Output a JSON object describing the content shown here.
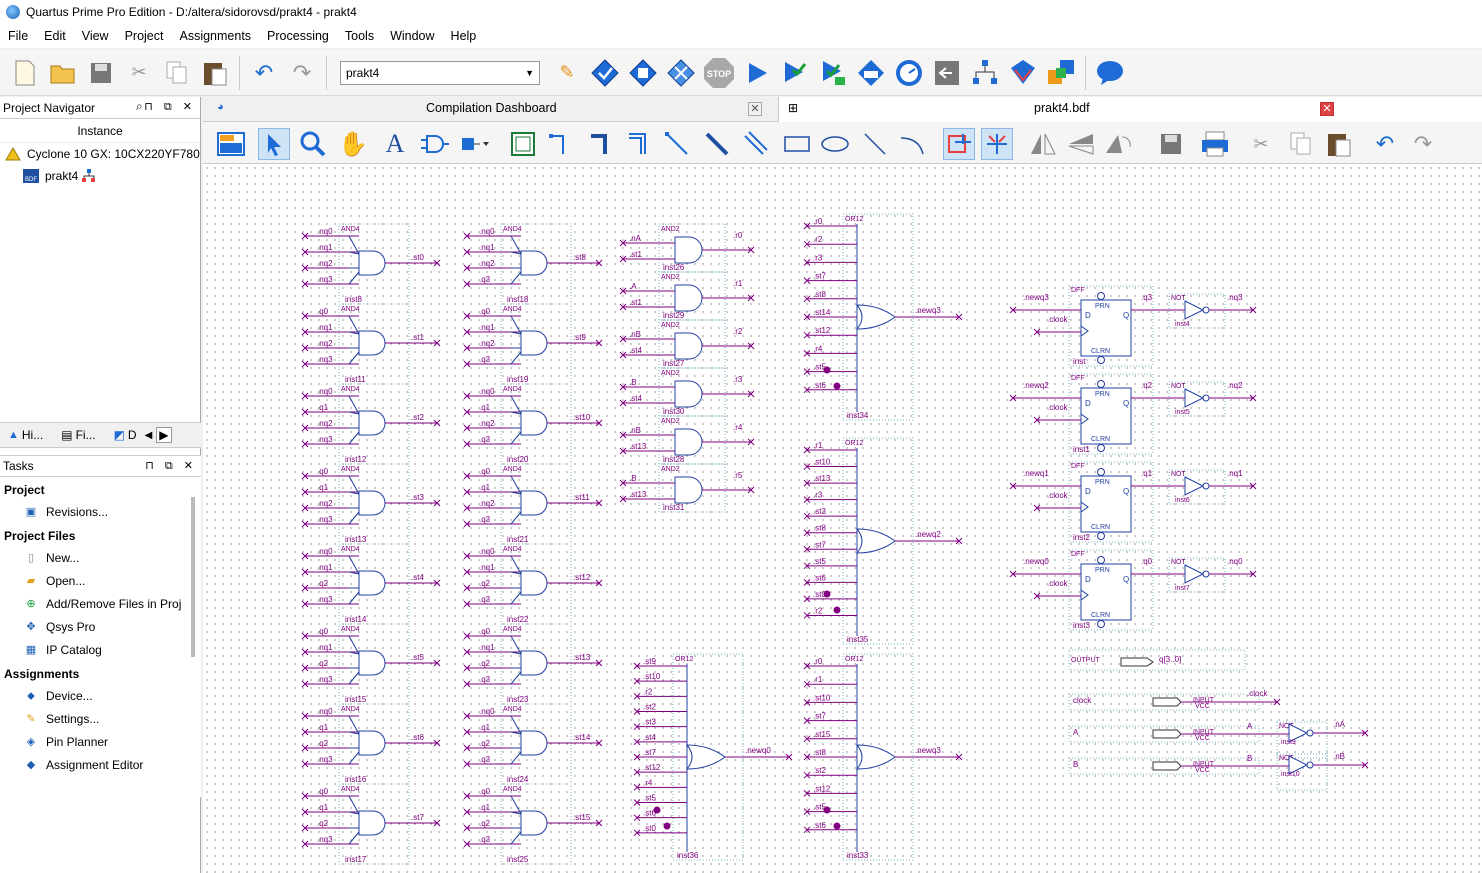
{
  "window": {
    "title": "Quartus Prime Pro Edition - D:/altera/sidorovsd/prakt4 - prakt4"
  },
  "menu": [
    "File",
    "Edit",
    "View",
    "Project",
    "Assignments",
    "Processing",
    "Tools",
    "Window",
    "Help"
  ],
  "toolbar": {
    "project_combo": "prakt4"
  },
  "navigator": {
    "title": "Project Navigator",
    "column": "Instance",
    "device": "Cyclone 10 GX: 10CX220YF780",
    "entity": "prakt4",
    "tabs": [
      "Hi...",
      "Fi...",
      "D"
    ]
  },
  "tasks": {
    "title": "Tasks",
    "groups": [
      {
        "name": "Project",
        "items": [
          "Revisions..."
        ]
      },
      {
        "name": "Project Files",
        "items": [
          "New...",
          "Open...",
          "Add/Remove Files in Proj",
          "Qsys Pro",
          "IP Catalog"
        ]
      },
      {
        "name": "Assignments",
        "items": [
          "Device...",
          "Settings...",
          "Pin Planner",
          "Assignment Editor"
        ]
      }
    ]
  },
  "doc_tabs": {
    "dashboard": "Compilation Dashboard",
    "bdf": "prakt4.bdf"
  },
  "schematic": {
    "and_col1": [
      {
        "inst": "inst8",
        "out": "st0",
        "ins": [
          "nq0",
          "nq1",
          "nq2",
          "nq3"
        ]
      },
      {
        "inst": "inst11",
        "out": "st1",
        "ins": [
          "q0",
          "nq1",
          "nq2",
          "nq3"
        ]
      },
      {
        "inst": "inst12",
        "out": "st2",
        "ins": [
          "nq0",
          "q1",
          "nq2",
          "nq3"
        ]
      },
      {
        "inst": "inst13",
        "out": "st3",
        "ins": [
          "q0",
          "q1",
          "nq2",
          "nq3"
        ]
      },
      {
        "inst": "inst14",
        "out": "st4",
        "ins": [
          "nq0",
          "nq1",
          "q2",
          "nq3"
        ]
      },
      {
        "inst": "inst15",
        "out": "st5",
        "ins": [
          "q0",
          "nq1",
          "q2",
          "nq3"
        ]
      },
      {
        "inst": "inst16",
        "out": "st6",
        "ins": [
          "nq0",
          "q1",
          "q2",
          "nq3"
        ]
      },
      {
        "inst": "inst17",
        "out": "st7",
        "ins": [
          "q0",
          "q1",
          "q2",
          "nq3"
        ]
      }
    ],
    "and_col2": [
      {
        "inst": "inst18",
        "out": "st8",
        "ins": [
          "nq0",
          "nq1",
          "nq2",
          "q3"
        ]
      },
      {
        "inst": "inst19",
        "out": "st9",
        "ins": [
          "q0",
          "nq1",
          "nq2",
          "q3"
        ]
      },
      {
        "inst": "inst20",
        "out": "st10",
        "ins": [
          "nq0",
          "q1",
          "nq2",
          "q3"
        ]
      },
      {
        "inst": "inst21",
        "out": "st11",
        "ins": [
          "q0",
          "q1",
          "nq2",
          "q3"
        ]
      },
      {
        "inst": "inst22",
        "out": "st12",
        "ins": [
          "nq0",
          "nq1",
          "q2",
          "q3"
        ]
      },
      {
        "inst": "inst23",
        "out": "st13",
        "ins": [
          "q0",
          "nq1",
          "q2",
          "q3"
        ]
      },
      {
        "inst": "inst24",
        "out": "st14",
        "ins": [
          "nq0",
          "q1",
          "q2",
          "q3"
        ]
      },
      {
        "inst": "inst25",
        "out": "st15",
        "ins": [
          "q0",
          "q1",
          "q2",
          "q3"
        ]
      }
    ],
    "and2": [
      {
        "inst": "inst26",
        "out": "r0",
        "ins": [
          "nA",
          "st1"
        ]
      },
      {
        "inst": "inst29",
        "out": "r1",
        "ins": [
          "A",
          "st1"
        ]
      },
      {
        "inst": "inst27",
        "out": "r2",
        "ins": [
          "nB",
          "st4"
        ]
      },
      {
        "inst": "inst30",
        "out": "r3",
        "ins": [
          "B",
          "st4"
        ]
      },
      {
        "inst": "inst28",
        "out": "r4",
        "ins": [
          "nB",
          "st13"
        ]
      },
      {
        "inst": "inst31",
        "out": "r5",
        "ins": [
          "B",
          "st13"
        ]
      }
    ],
    "or12": [
      {
        "inst": "inst34",
        "out": "newq3",
        "ins": [
          "r0",
          "r2",
          "r3",
          "st7",
          "st8",
          "st14",
          "st12",
          "r4",
          "st5",
          "st6"
        ]
      },
      {
        "inst": "inst35",
        "out": "newq2",
        "ins": [
          "r1",
          "st10",
          "st13",
          "r3",
          "st3",
          "st8",
          "st7",
          "st5",
          "st6",
          "st0",
          "r2"
        ]
      },
      {
        "inst": "inst36",
        "out": "newq0",
        "ins": [
          "st9",
          "st10",
          "r2",
          "st2",
          "st3",
          "st4",
          "st7",
          "st12",
          "r4",
          "st5",
          "st6",
          "st0"
        ]
      },
      {
        "inst": "inst33",
        "out": "newq3",
        "ins": [
          "r0",
          "r1",
          "st10",
          "st7",
          "st15",
          "st8",
          "st2",
          "st12",
          "st5",
          "st6"
        ]
      }
    ],
    "dff": [
      {
        "inst": "inst",
        "d": "newq3",
        "q": "q3",
        "nq": "nq3",
        "not": "inst4"
      },
      {
        "inst": "inst1",
        "d": "newq2",
        "q": "q2",
        "nq": "nq2",
        "not": "inst5"
      },
      {
        "inst": "inst2",
        "d": "newq1",
        "q": "q1",
        "nq": "nq1",
        "not": "inst6"
      },
      {
        "inst": "inst3",
        "d": "newq0",
        "q": "q0",
        "nq": "nq0",
        "not": "inst7"
      }
    ],
    "dff_labels": {
      "type": "DFF",
      "prn": "PRN",
      "clrn": "CLRN",
      "d": "D",
      "q": "Q",
      "clock": "clock",
      "and4": "AND4",
      "and2": "AND2",
      "or12": "OR12",
      "not": "NOT"
    },
    "output_pin": {
      "type": "OUTPUT",
      "name": "q[3..0]"
    },
    "inputs": [
      {
        "name": "clock",
        "type": "INPUT",
        "vcc": "VCC",
        "net": "clock"
      },
      {
        "name": "A",
        "type": "INPUT",
        "vcc": "VCC",
        "net": "A",
        "not": "inst9",
        "nnet": "nA"
      },
      {
        "name": "B",
        "type": "INPUT",
        "vcc": "VCC",
        "net": "B",
        "not": "inst10",
        "nnet": "nB"
      }
    ]
  }
}
